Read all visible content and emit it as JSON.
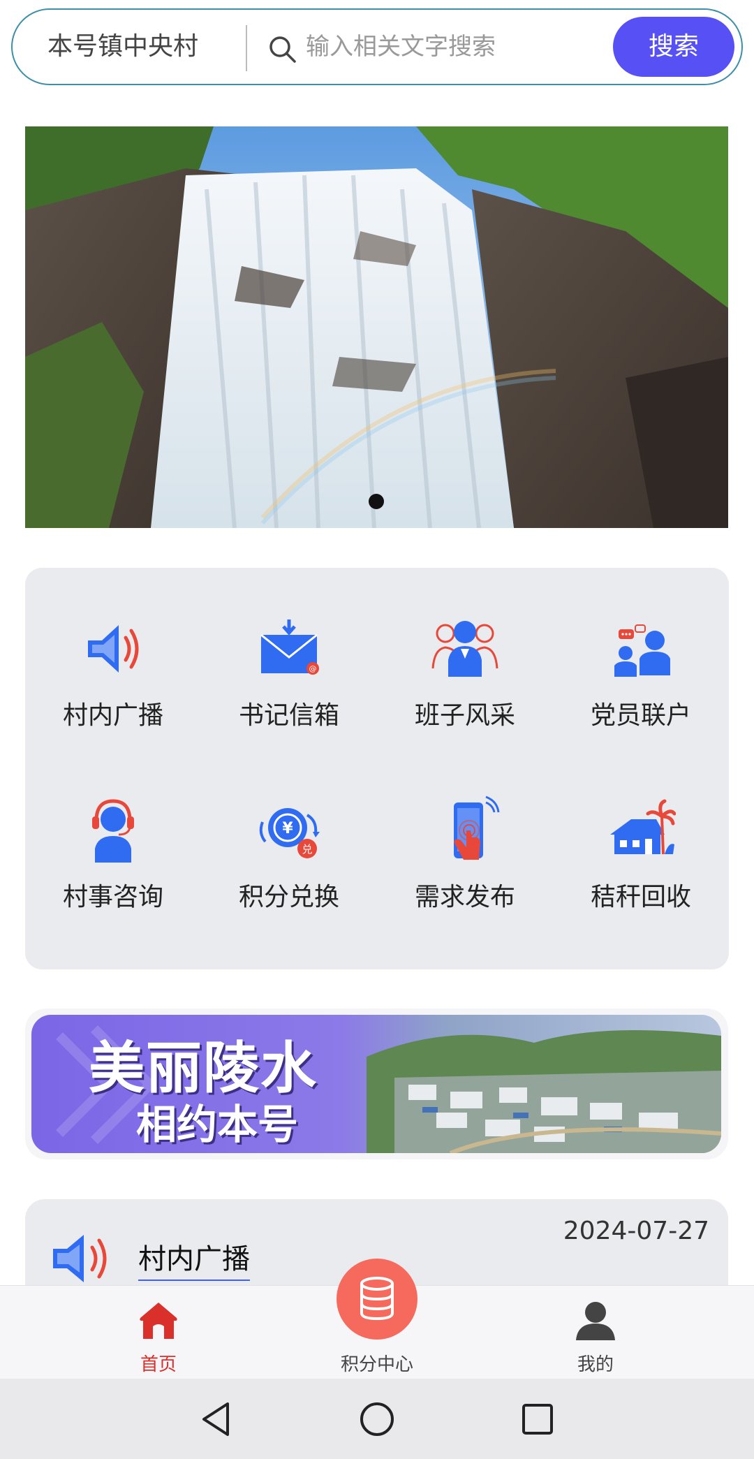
{
  "search": {
    "village": "本号镇中央村",
    "placeholder": "输入相关文字搜索",
    "button_label": "搜索"
  },
  "hero": {
    "icon": "waterfall-photo",
    "active_slide": 1,
    "slide_count": 1
  },
  "features": [
    {
      "label": "村内广播",
      "icon": "speaker-icon"
    },
    {
      "label": "书记信箱",
      "icon": "mail-icon"
    },
    {
      "label": "班子风采",
      "icon": "team-icon"
    },
    {
      "label": "党员联户",
      "icon": "members-chat-icon"
    },
    {
      "label": "村事咨询",
      "icon": "headset-icon"
    },
    {
      "label": "积分兑换",
      "icon": "points-exchange-icon"
    },
    {
      "label": "需求发布",
      "icon": "phone-touch-icon"
    },
    {
      "label": "秸秆回收",
      "icon": "house-palm-icon"
    }
  ],
  "promo": {
    "line1": "美丽陵水",
    "line2": "相约本号"
  },
  "broadcast": {
    "title": "村内广播",
    "date": "2024-07-27",
    "icon": "speaker-icon"
  },
  "bottom_nav": {
    "home": "首页",
    "points": "积分中心",
    "mine": "我的",
    "active": "home"
  },
  "colors": {
    "accent": "#5750f5",
    "icon_blue": "#2f6cf2",
    "icon_red": "#e8483a",
    "nav_active": "#d9302c",
    "center_button": "#f56a5c"
  }
}
